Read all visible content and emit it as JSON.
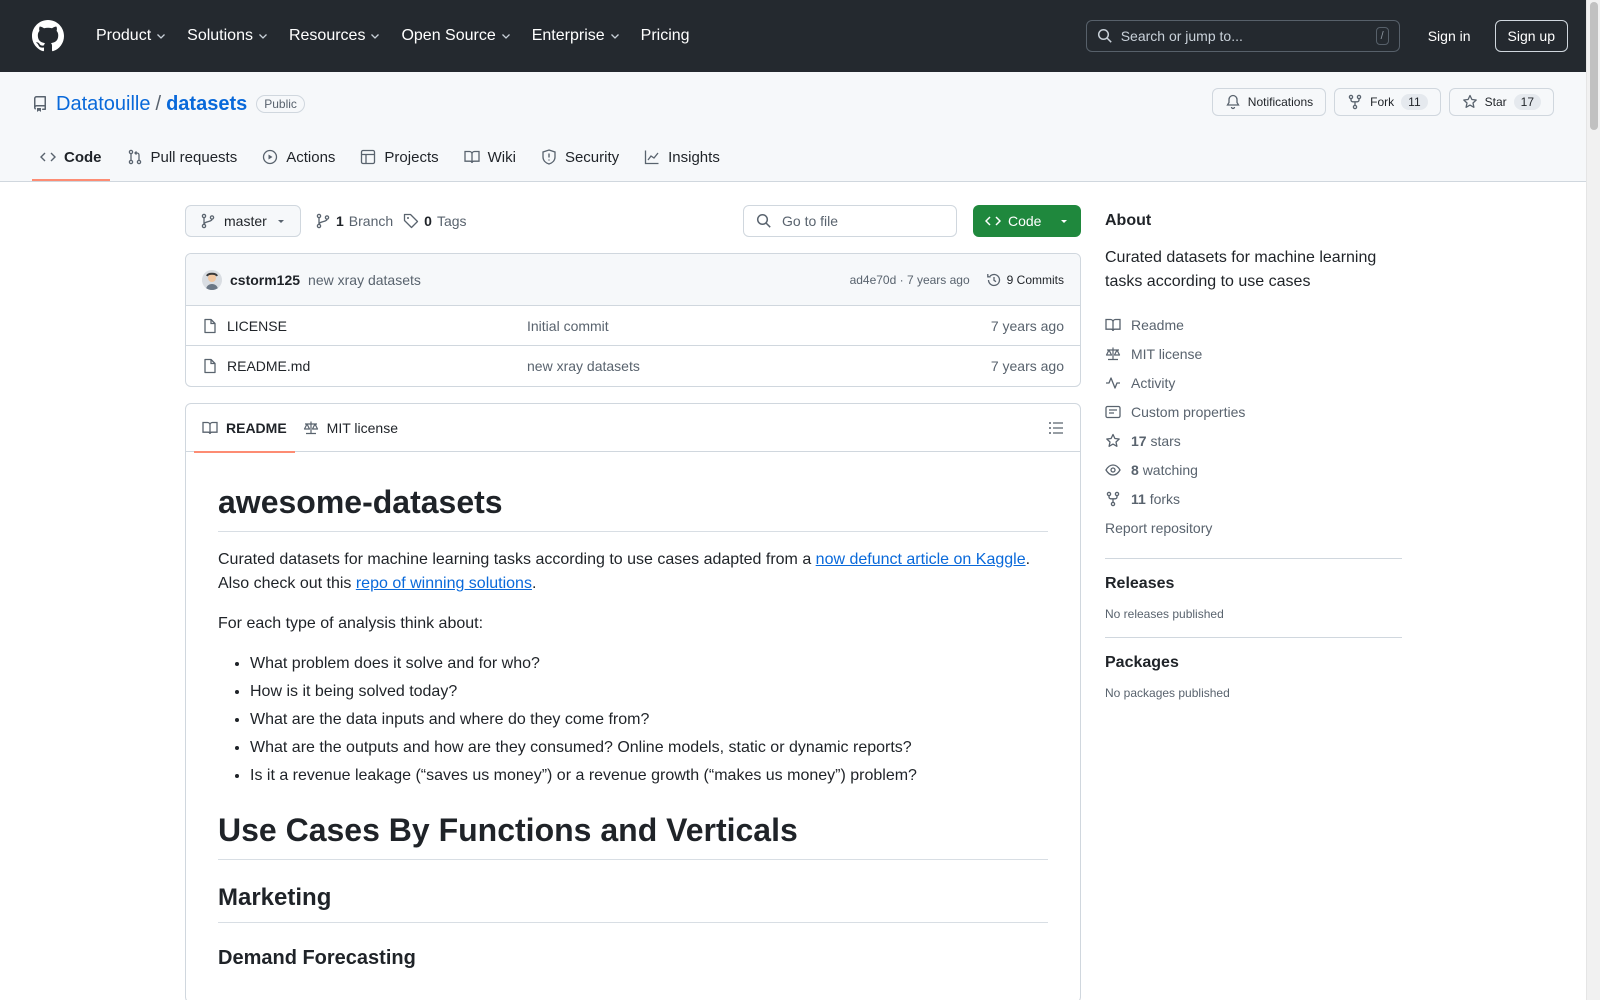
{
  "header": {
    "nav": [
      "Product",
      "Solutions",
      "Resources",
      "Open Source",
      "Enterprise",
      "Pricing"
    ],
    "search_placeholder": "Search or jump to...",
    "search_shortcut": "/",
    "sign_in": "Sign in",
    "sign_up": "Sign up"
  },
  "repo": {
    "owner": "Datatouille",
    "separator": "/",
    "name": "datasets",
    "visibility": "Public",
    "notifications_label": "Notifications",
    "fork_label": "Fork",
    "fork_count": "11",
    "star_label": "Star",
    "star_count": "17",
    "tabs": [
      "Code",
      "Pull requests",
      "Actions",
      "Projects",
      "Wiki",
      "Security",
      "Insights"
    ]
  },
  "toolbar": {
    "branch": "master",
    "branch_count": "1",
    "branch_label": "Branch",
    "tag_count": "0",
    "tag_label": "Tags",
    "goto_placeholder": "Go to file",
    "code_label": "Code"
  },
  "commit": {
    "author": "cstorm125",
    "message": "new xray datasets",
    "meta": "ad4e70d · 7 years ago",
    "count_label": "9 Commits"
  },
  "files": [
    {
      "name": "LICENSE",
      "message": "Initial commit",
      "time": "7 years ago"
    },
    {
      "name": "README.md",
      "message": "new xray datasets",
      "time": "7 years ago"
    }
  ],
  "readme": {
    "tab_readme": "README",
    "tab_license": "MIT license",
    "title": "awesome-datasets",
    "intro_before": "Curated datasets for machine learning tasks according to use cases adapted from a ",
    "intro_link1": "now defunct article on Kaggle",
    "intro_mid": ". Also check out this ",
    "intro_link2": "repo of winning solutions",
    "intro_end": ".",
    "para2": "For each type of analysis think about:",
    "bullets": [
      "What problem does it solve and for who?",
      "How is it being solved today?",
      "What are the data inputs and where do they come from?",
      "What are the outputs and how are they consumed? Online models, static or dynamic reports?",
      "Is it a revenue leakage (“saves us money”) or a revenue growth (“makes us money”) problem?"
    ],
    "h1_2": "Use Cases By Functions and Verticals",
    "h2": "Marketing",
    "h3": "Demand Forecasting"
  },
  "about": {
    "heading": "About",
    "description": "Curated datasets for machine learning tasks according to use cases",
    "links": {
      "readme": "Readme",
      "license": "MIT license",
      "activity": "Activity",
      "custom": "Custom properties",
      "stars_count": "17",
      "stars_label": "stars",
      "watching_count": "8",
      "watching_label": "watching",
      "forks_count": "11",
      "forks_label": "forks"
    },
    "report": "Report repository"
  },
  "releases": {
    "heading": "Releases",
    "empty": "No releases published"
  },
  "packages": {
    "heading": "Packages",
    "empty": "No packages published"
  }
}
